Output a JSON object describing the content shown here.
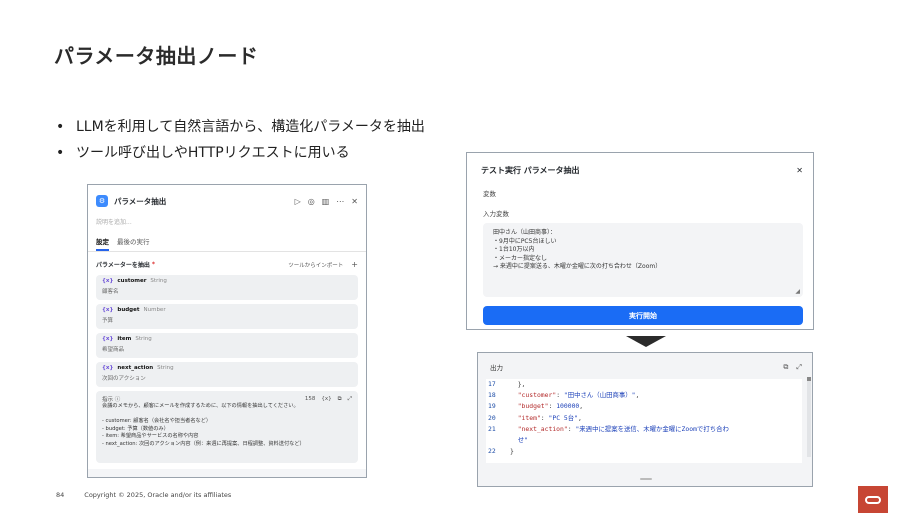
{
  "slide": {
    "title": "パラメータ抽出ノード",
    "bullets": [
      "LLMを利用して自然言語から、構造化パラメータを抽出",
      "ツール呼び出しやHTTPリクエストに用いる"
    ],
    "bullet_marker": "•"
  },
  "left_panel": {
    "logo": "⚙",
    "title": "パラメータ抽出",
    "header_icons": [
      "▷",
      "◎",
      "▥",
      "⋯",
      "✕"
    ],
    "description_placeholder": "説明を追加...",
    "tabs": [
      "設定",
      "最後の実行"
    ],
    "params_label": "パラメーターを抽出",
    "required_mark": "*",
    "import_label": "ツールからインポート",
    "add_icon": "+",
    "var_icon": "{x}",
    "params": [
      {
        "name": "customer",
        "type": "String",
        "desc": "顧客名"
      },
      {
        "name": "budget",
        "type": "Number",
        "desc": "予算"
      },
      {
        "name": "item",
        "type": "String",
        "desc": "希望商品"
      },
      {
        "name": "next_action",
        "type": "String",
        "desc": "次回のアクション"
      }
    ],
    "instruction": {
      "label": "指示 ⓘ",
      "count": "158",
      "var_icon": "{x}",
      "copy_icon": "⧉",
      "expand_icon": "⤢",
      "lines": [
        "会議のメモから、顧客にメールを作成するために、以下の情報を抽出してください。",
        "",
        "- customer: 顧客名（会社名や担当者名など）",
        "- budget: 予算（数値のみ）",
        "- item: 希望商品やサービスの名称や内容",
        "- next_action: 次回のアクション内容（例：来週に再提案、日程調整、資料送付など）"
      ]
    }
  },
  "right_top_panel": {
    "title": "テスト実行 パラメータ抽出",
    "close_icon": "✕",
    "variables_label": "変数",
    "input_label": "入力変数",
    "input_lines": [
      "田中さん（山田商事）：",
      "・9月中にPC5台ほしい",
      "・1台10万以内",
      "・メーカー指定なし",
      "→ 来週中に提案送る、木曜か金曜に次の打ち合わせ（Zoom）"
    ],
    "resize_icon": "◢",
    "run_button": "実行開始"
  },
  "right_bottom_panel": {
    "title": "出力",
    "icons": [
      "⧉",
      "⤢"
    ],
    "code_lines": [
      {
        "ln": "17",
        "indent": "  ",
        "parts": [
          {
            "t": "},",
            "c": "p"
          }
        ]
      },
      {
        "ln": "18",
        "indent": "  ",
        "parts": [
          {
            "t": "\"customer\"",
            "c": "k"
          },
          {
            "t": ": ",
            "c": "p"
          },
          {
            "t": "\"田中さん（山田商事）\"",
            "c": "s"
          },
          {
            "t": ",",
            "c": "p"
          }
        ]
      },
      {
        "ln": "19",
        "indent": "  ",
        "parts": [
          {
            "t": "\"budget\"",
            "c": "k"
          },
          {
            "t": ": ",
            "c": "p"
          },
          {
            "t": "100000",
            "c": "n"
          },
          {
            "t": ",",
            "c": "p"
          }
        ]
      },
      {
        "ln": "20",
        "indent": "  ",
        "parts": [
          {
            "t": "\"item\"",
            "c": "k"
          },
          {
            "t": ": ",
            "c": "p"
          },
          {
            "t": "\"PC 5台\"",
            "c": "s"
          },
          {
            "t": ",",
            "c": "p"
          }
        ]
      },
      {
        "ln": "21",
        "indent": "  ",
        "parts": [
          {
            "t": "\"next_action\"",
            "c": "k"
          },
          {
            "t": ": ",
            "c": "p"
          },
          {
            "t": "\"来週中に提案を送信、木曜か金曜にZoomで打ち合わ",
            "c": "s"
          }
        ]
      },
      {
        "ln": "",
        "indent": "  ",
        "parts": [
          {
            "t": "せ\"",
            "c": "s"
          }
        ]
      },
      {
        "ln": "22",
        "indent": "",
        "parts": [
          {
            "t": "}",
            "c": "p"
          }
        ]
      }
    ]
  },
  "footer": {
    "page_number": "84",
    "copyright": "Copyright © 2025, Oracle and/or its affiliates"
  },
  "colors": {
    "accent": "#1a6cf5",
    "oracle_red": "#c74634",
    "json_key": "#b32b2b",
    "json_value": "#1a3fb8"
  }
}
